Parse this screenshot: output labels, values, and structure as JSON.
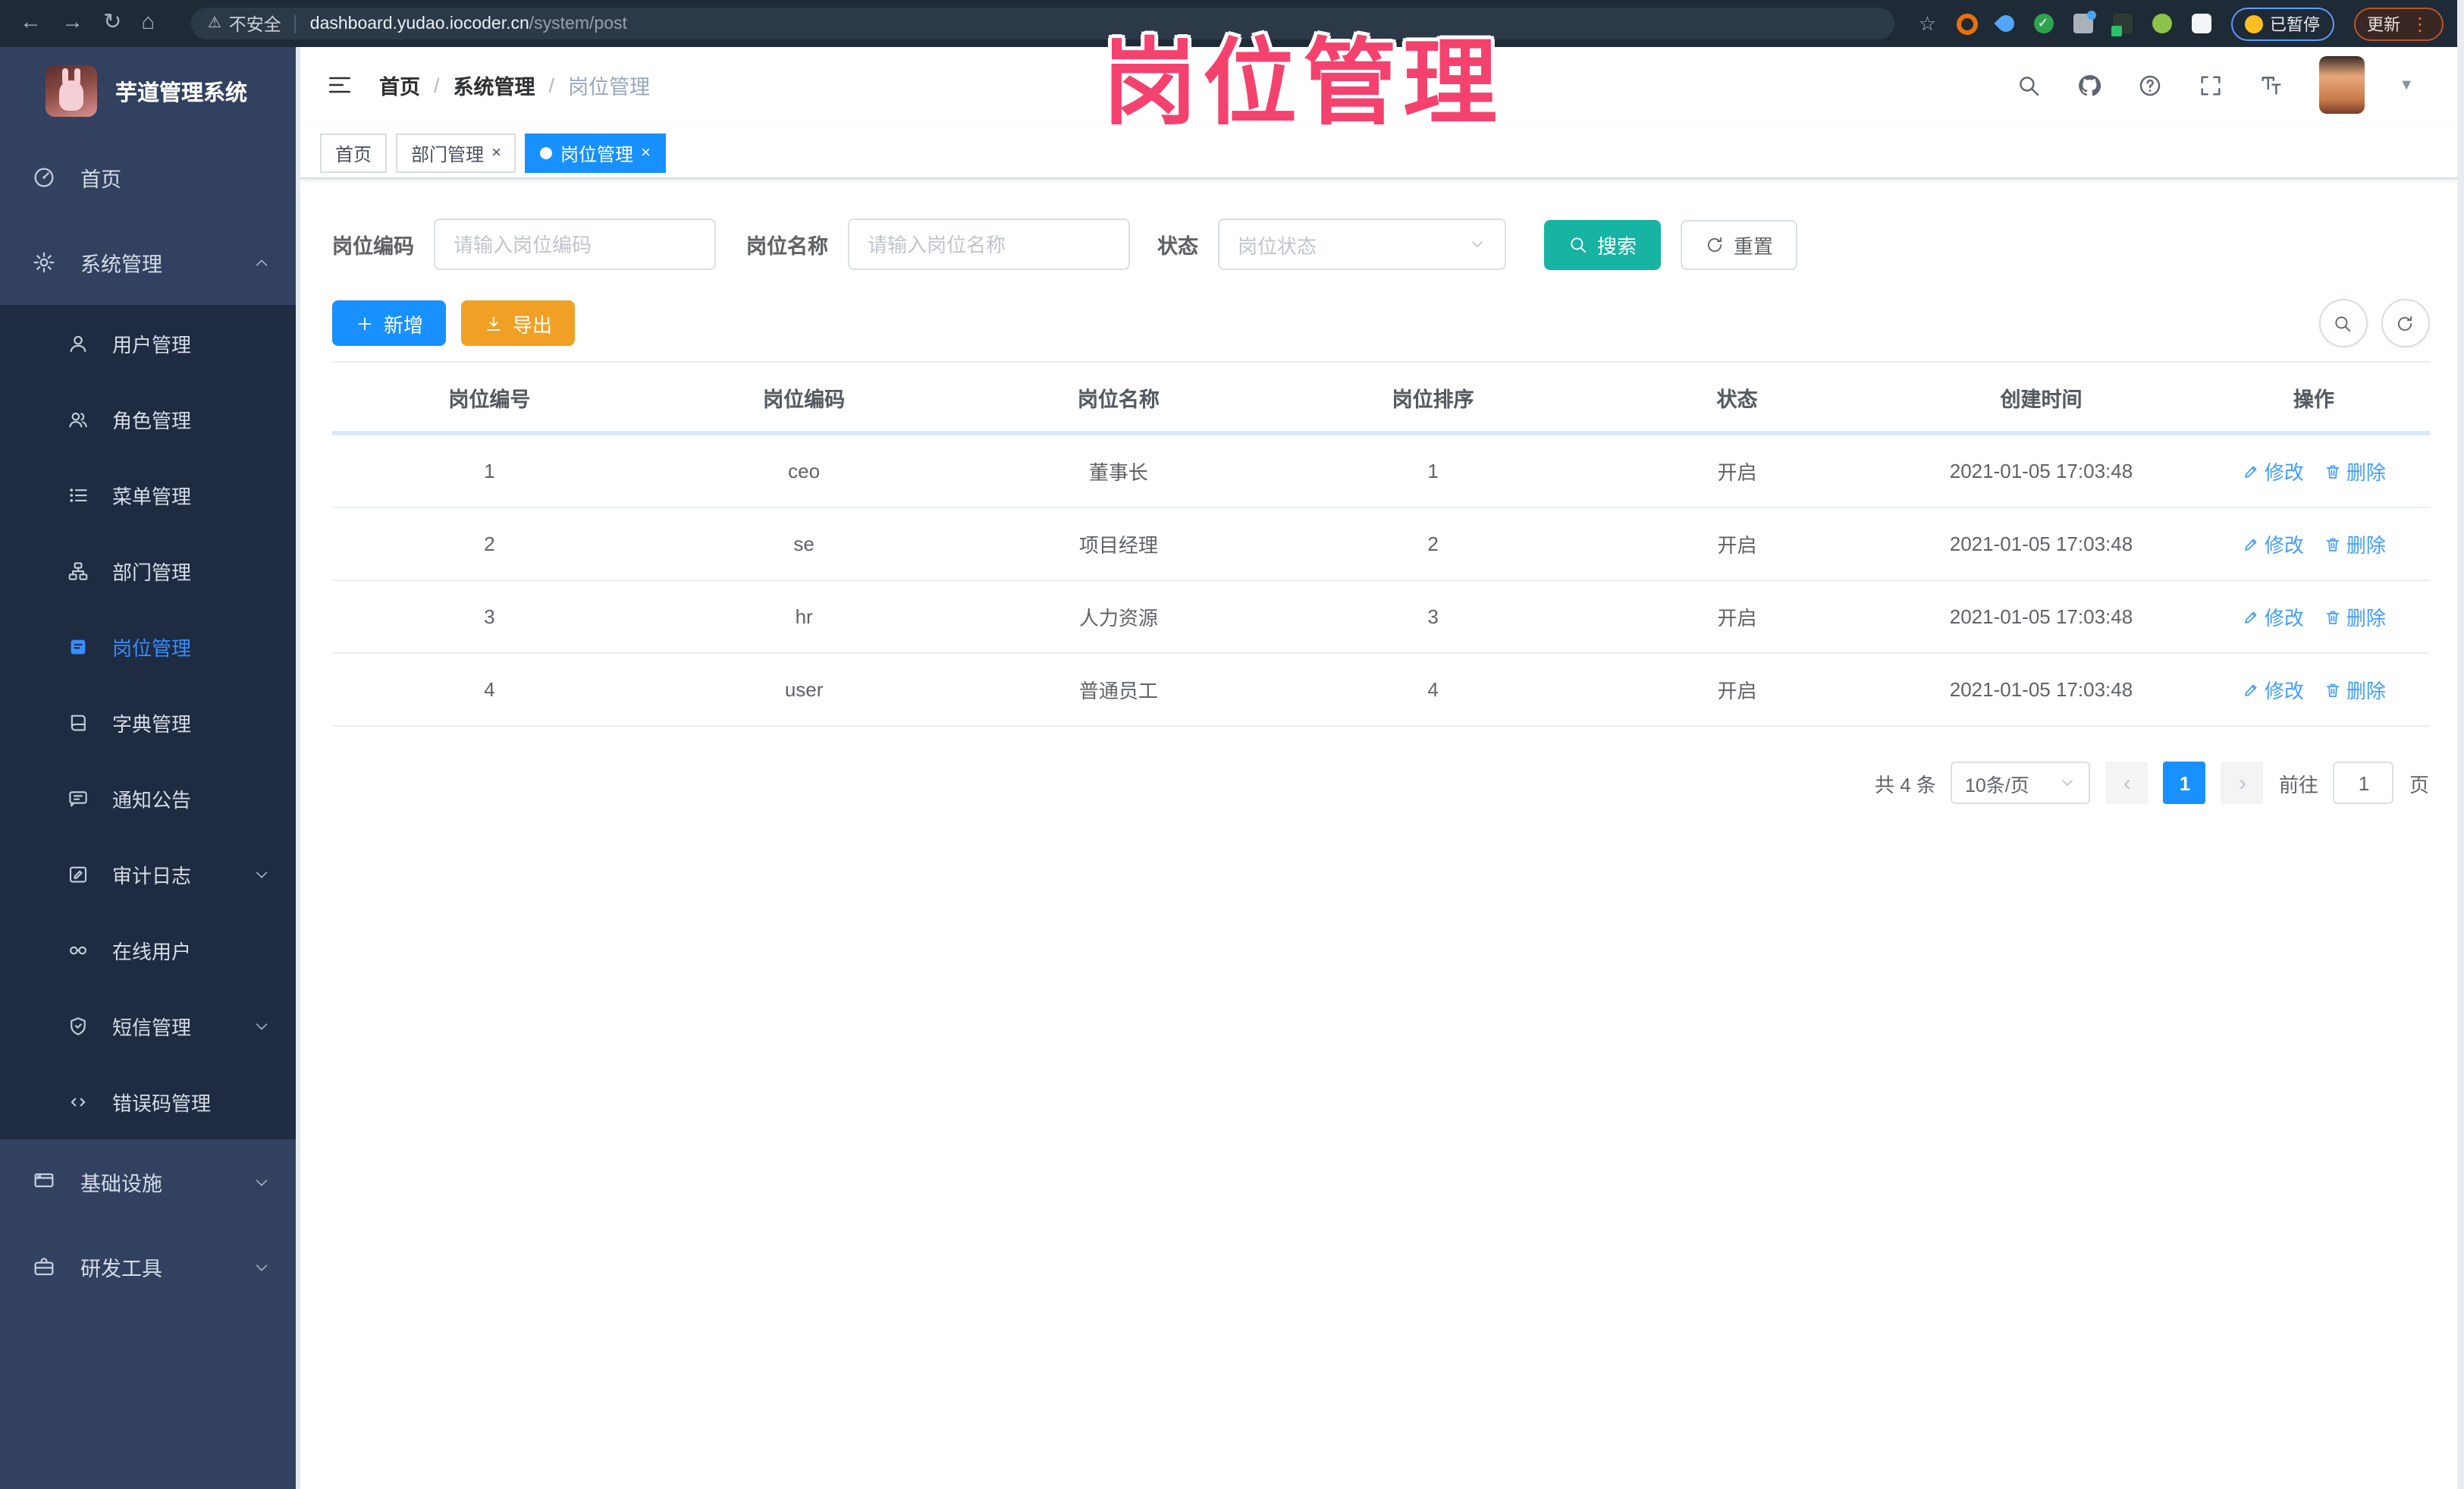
{
  "colors": {
    "accent": "#1890ff",
    "teal": "#17b3a3",
    "warning": "#f0a125",
    "link": "#409eff",
    "annotation": "#f4426e",
    "sidebar": "#32415f",
    "submenu": "#1e2b41"
  },
  "annotation": {
    "text": "岗位管理"
  },
  "browser": {
    "security_label": "不安全",
    "url_host": "dashboard.yudao.iocoder.cn",
    "url_path": "/system/post",
    "paused_label": "已暂停",
    "update_label": "更新"
  },
  "sidebar": {
    "app_title": "芋道管理系统",
    "items": [
      {
        "label": "首页"
      },
      {
        "label": "系统管理"
      },
      {
        "label": "用户管理"
      },
      {
        "label": "角色管理"
      },
      {
        "label": "菜单管理"
      },
      {
        "label": "部门管理"
      },
      {
        "label": "岗位管理"
      },
      {
        "label": "字典管理"
      },
      {
        "label": "通知公告"
      },
      {
        "label": "审计日志"
      },
      {
        "label": "在线用户"
      },
      {
        "label": "短信管理"
      },
      {
        "label": "错误码管理"
      },
      {
        "label": "基础设施"
      },
      {
        "label": "研发工具"
      }
    ]
  },
  "breadcrumb": {
    "sep": "/",
    "items": [
      "首页",
      "系统管理",
      "岗位管理"
    ]
  },
  "tabs": [
    {
      "label": "首页"
    },
    {
      "label": "部门管理",
      "close": "×"
    },
    {
      "label": "岗位管理",
      "close": "×"
    }
  ],
  "search": {
    "code_label": "岗位编码",
    "code_placeholder": "请输入岗位编码",
    "name_label": "岗位名称",
    "name_placeholder": "请输入岗位名称",
    "status_label": "状态",
    "status_placeholder": "岗位状态",
    "search_label": "搜索",
    "reset_label": "重置"
  },
  "toolbar": {
    "add_label": "新增",
    "export_label": "导出"
  },
  "table": {
    "columns": [
      "岗位编号",
      "岗位编码",
      "岗位名称",
      "岗位排序",
      "状态",
      "创建时间",
      "操作"
    ],
    "edit_label": "修改",
    "delete_label": "删除",
    "rows": [
      {
        "id": "1",
        "code": "ceo",
        "name": "董事长",
        "sort": "1",
        "status": "开启",
        "created": "2021-01-05 17:03:48"
      },
      {
        "id": "2",
        "code": "se",
        "name": "项目经理",
        "sort": "2",
        "status": "开启",
        "created": "2021-01-05 17:03:48"
      },
      {
        "id": "3",
        "code": "hr",
        "name": "人力资源",
        "sort": "3",
        "status": "开启",
        "created": "2021-01-05 17:03:48"
      },
      {
        "id": "4",
        "code": "user",
        "name": "普通员工",
        "sort": "4",
        "status": "开启",
        "created": "2021-01-05 17:03:48"
      }
    ]
  },
  "pagination": {
    "total": "共 4 条",
    "page_size": "10条/页",
    "page": "1",
    "goto": "前往",
    "goto_value": "1",
    "unit": "页"
  }
}
